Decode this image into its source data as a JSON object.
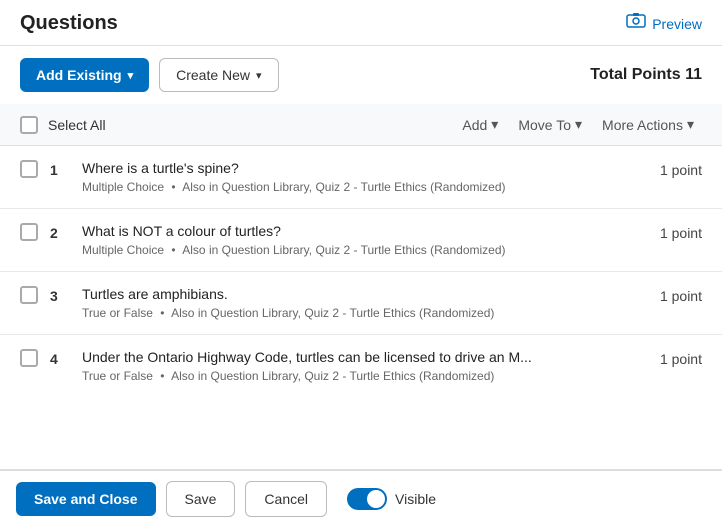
{
  "header": {
    "title": "Questions",
    "preview_label": "Preview"
  },
  "toolbar": {
    "add_existing_label": "Add Existing",
    "create_new_label": "Create New",
    "total_points_label": "Total Points 11"
  },
  "select_all_row": {
    "select_all_label": "Select All",
    "add_label": "Add",
    "move_to_label": "Move To",
    "more_actions_label": "More Actions"
  },
  "questions": [
    {
      "number": "1",
      "text": "Where is a turtle's spine?",
      "meta_type": "Multiple Choice",
      "meta_location": "Also in Question Library, Quiz 2 - Turtle Ethics (Randomized)",
      "points": "1 point"
    },
    {
      "number": "2",
      "text": "What is NOT a colour of turtles?",
      "meta_type": "Multiple Choice",
      "meta_location": "Also in Question Library, Quiz 2 - Turtle Ethics (Randomized)",
      "points": "1 point"
    },
    {
      "number": "3",
      "text": "Turtles are amphibians.",
      "meta_type": "True or False",
      "meta_location": "Also in Question Library, Quiz 2 - Turtle Ethics (Randomized)",
      "points": "1 point"
    },
    {
      "number": "4",
      "text": "Under the Ontario Highway Code, turtles can be licensed to drive an M...",
      "meta_type": "True or False",
      "meta_location": "Also in Question Library, Quiz 2 - Turtle Ethics (Randomized)",
      "points": "1 point"
    }
  ],
  "footer": {
    "save_and_close_label": "Save and Close",
    "save_label": "Save",
    "cancel_label": "Cancel",
    "visible_label": "Visible"
  }
}
